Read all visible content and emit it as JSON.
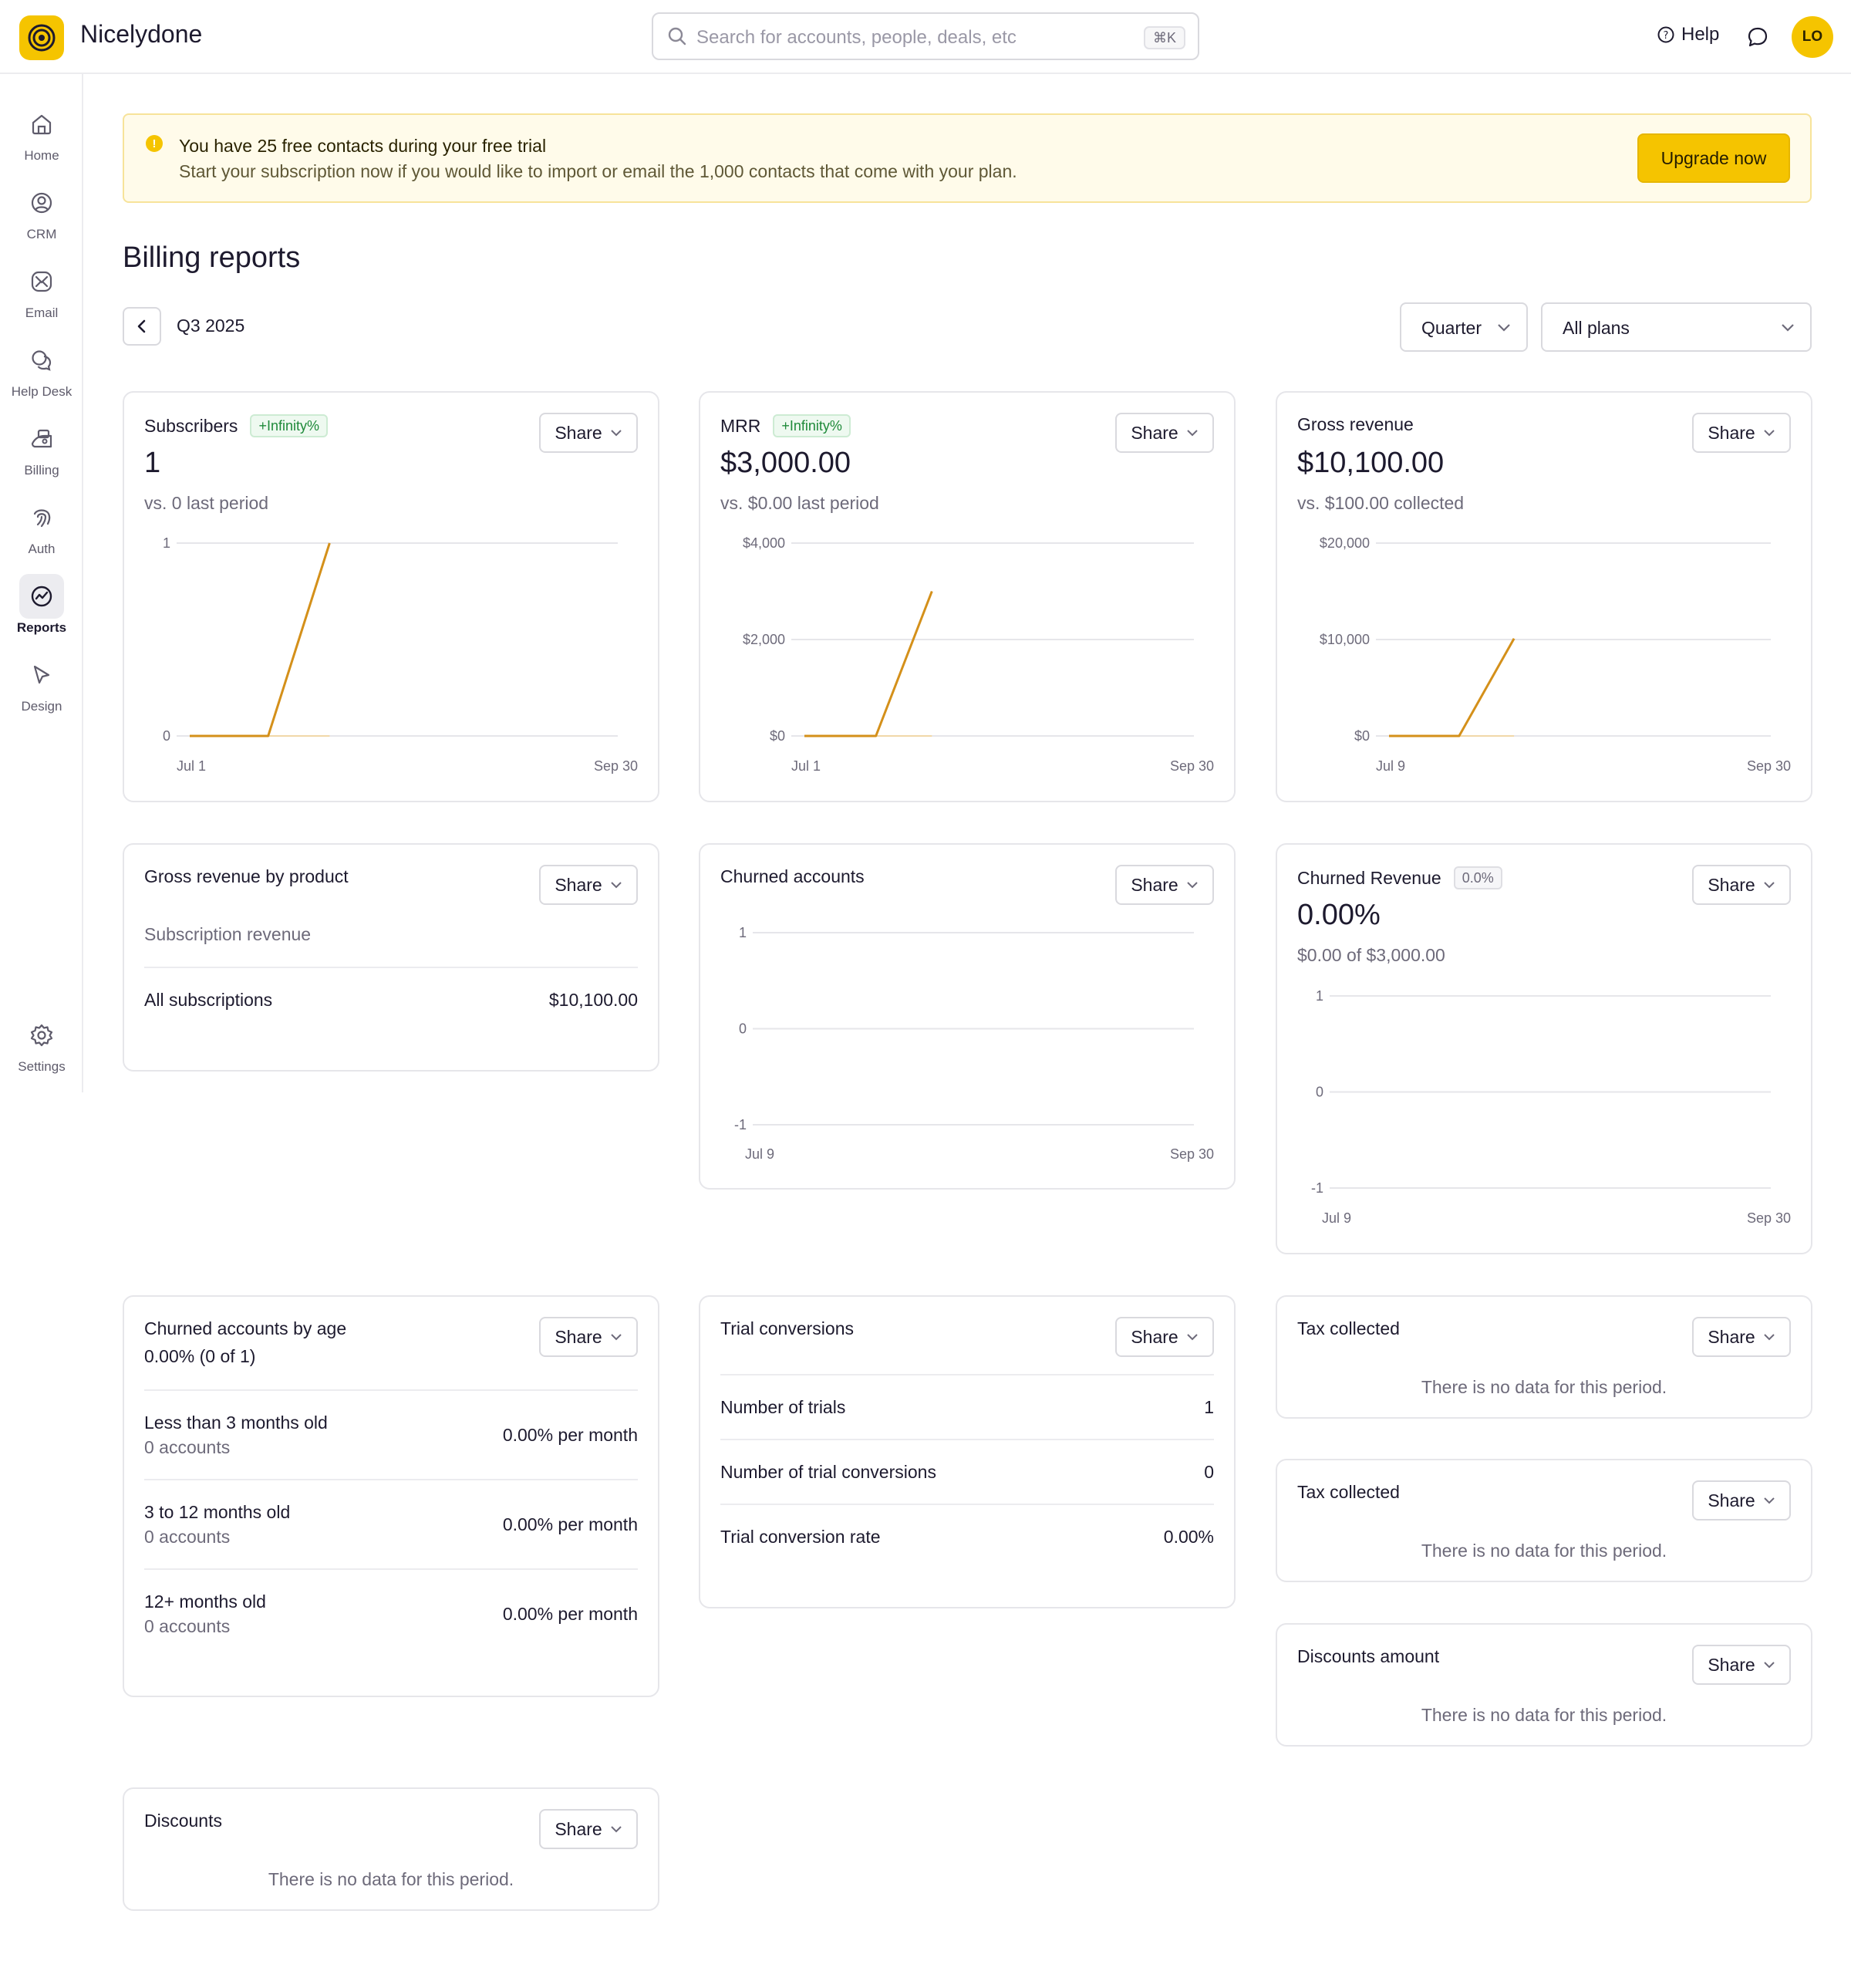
{
  "app": {
    "name": "Nicelydone",
    "avatar_initials": "LO",
    "help_label": "Help",
    "accent_color": "#f5c400",
    "line_color": "#d4901a"
  },
  "search": {
    "placeholder": "Search for accounts, people, deals, etc",
    "shortcut": "⌘K"
  },
  "sidebar": {
    "items": [
      {
        "label": "Home",
        "icon": "home-icon"
      },
      {
        "label": "CRM",
        "icon": "user-circle-icon"
      },
      {
        "label": "Email",
        "icon": "mail-icon"
      },
      {
        "label": "Help Desk",
        "icon": "chat-bubbles-icon"
      },
      {
        "label": "Billing",
        "icon": "billing-icon"
      },
      {
        "label": "Auth",
        "icon": "fingerprint-icon"
      },
      {
        "label": "Reports",
        "icon": "chart-icon",
        "active": true
      },
      {
        "label": "Design",
        "icon": "cursor-icon"
      },
      {
        "label": "Settings",
        "icon": "gear-icon"
      }
    ]
  },
  "banner": {
    "title": "You have 25 free contacts during your free trial",
    "text": "Start your subscription now if you would like to import or email the 1,000 contacts that come with your plan.",
    "button": "Upgrade now"
  },
  "page": {
    "title": "Billing reports",
    "period": "Q3 2025",
    "interval_select": "Quarter",
    "plan_select": "All plans"
  },
  "share_label": "Share",
  "no_data": "There is no data for this period.",
  "cards": {
    "subscribers": {
      "title": "Subscribers",
      "badge": "+Infinity%",
      "value": "1",
      "sub": "vs. 0 last period"
    },
    "mrr": {
      "title": "MRR",
      "badge": "+Infinity%",
      "value": "$3,000.00",
      "sub": "vs. $0.00 last period"
    },
    "gross_revenue": {
      "title": "Gross revenue",
      "value": "$10,100.00",
      "sub": "vs. $100.00 collected"
    },
    "by_product": {
      "title": "Gross revenue by product",
      "section": "Subscription revenue",
      "row_label": "All subscriptions",
      "row_value": "$10,100.00"
    },
    "churned_accounts": {
      "title": "Churned accounts"
    },
    "churned_revenue": {
      "title": "Churned Revenue",
      "badge": "0.0%",
      "value": "0.00%",
      "sub": "$0.00 of $3,000.00"
    },
    "churn_by_age": {
      "title": "Churned accounts by age",
      "sub": "0.00% (0 of 1)",
      "rows": [
        {
          "label": "Less than 3 months old",
          "sub": "0 accounts",
          "value": "0.00% per month"
        },
        {
          "label": "3 to 12 months old",
          "sub": "0 accounts",
          "value": "0.00% per month"
        },
        {
          "label": "12+ months old",
          "sub": "0 accounts",
          "value": "0.00% per month"
        }
      ]
    },
    "trial_conversions": {
      "title": "Trial conversions",
      "rows": [
        {
          "label": "Number of trials",
          "value": "1"
        },
        {
          "label": "Number of trial conversions",
          "value": "0"
        },
        {
          "label": "Trial conversion rate",
          "value": "0.00%"
        }
      ]
    },
    "tax_1": {
      "title": "Tax collected"
    },
    "tax_2": {
      "title": "Tax collected"
    },
    "discounts_amount": {
      "title": "Discounts amount"
    },
    "discounts": {
      "title": "Discounts"
    }
  },
  "chart_data": [
    {
      "id": "subscribers",
      "type": "line",
      "ylim": [
        0,
        1
      ],
      "yticks": [
        "1",
        "0"
      ],
      "xticks": [
        "Jul 1",
        "Sep 30"
      ],
      "x": [
        "Jul 1",
        "Jul 15",
        "Jul 29",
        "Aug 1"
      ],
      "series": [
        {
          "values": [
            0,
            0,
            0,
            1
          ]
        }
      ]
    },
    {
      "id": "mrr",
      "type": "line",
      "ylim": [
        0,
        4000
      ],
      "yticks": [
        "$4,000",
        "$2,000",
        "$0"
      ],
      "xticks": [
        "Jul 1",
        "Sep 30"
      ],
      "x": [
        "Jul 1",
        "Jul 15",
        "Jul 29",
        "Aug 1"
      ],
      "series": [
        {
          "values": [
            0,
            0,
            0,
            3000
          ]
        }
      ]
    },
    {
      "id": "gross_revenue",
      "type": "line",
      "ylim": [
        0,
        20000
      ],
      "yticks": [
        "$20,000",
        "$10,000",
        "$0"
      ],
      "xticks": [
        "Jul 9",
        "Sep 30"
      ],
      "x": [
        "Jul 9",
        "Jul 18",
        "Jul 27",
        "Aug 1"
      ],
      "series": [
        {
          "values": [
            0,
            0,
            0,
            10100
          ]
        }
      ]
    },
    {
      "id": "churned_accounts",
      "type": "line",
      "ylim": [
        -1,
        1
      ],
      "yticks": [
        "1",
        "0",
        "-1"
      ],
      "xticks": [
        "Jul 9",
        "Sep 30"
      ],
      "series": []
    },
    {
      "id": "churned_revenue",
      "type": "line",
      "ylim": [
        -1,
        1
      ],
      "yticks": [
        "1",
        "0",
        "-1"
      ],
      "xticks": [
        "Jul 9",
        "Sep 30"
      ],
      "series": []
    }
  ]
}
